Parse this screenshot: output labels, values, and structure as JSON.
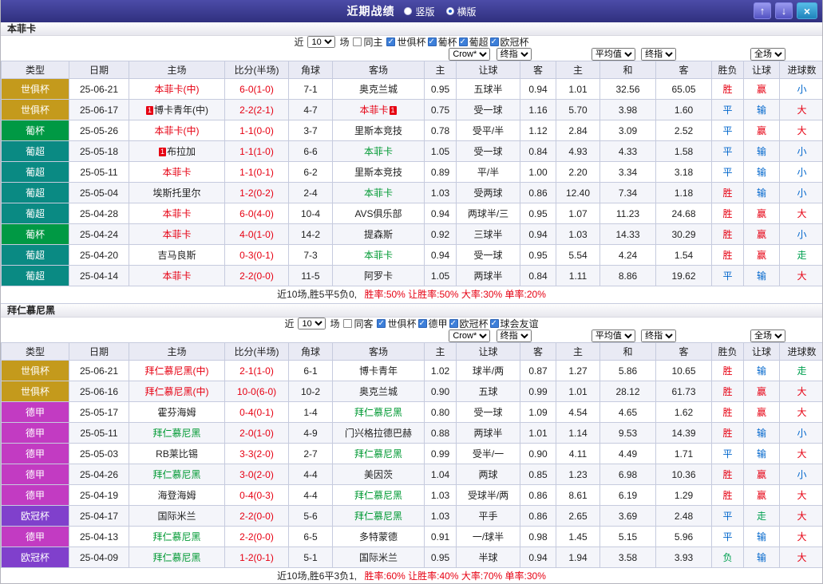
{
  "top_bar": {
    "title": "近期战绩",
    "view_options": [
      {
        "label": "竖版",
        "selected": false
      },
      {
        "label": "横版",
        "selected": true
      }
    ],
    "up_button": "↑",
    "down_button": "↓",
    "close_button": "×"
  },
  "filter_labels": {
    "prefix": "近",
    "suffix": "场"
  },
  "selects": {
    "bookmaker": "Crow*",
    "final1": "终指",
    "average": "平均值",
    "final2": "终指",
    "fulltime": "全场"
  },
  "table_columns": {
    "type": "类型",
    "date": "日期",
    "home": "主场",
    "score": "比分(半场)",
    "corner": "角球",
    "away": "客场",
    "ah_home": "主",
    "ah_line": "让球",
    "ah_away": "客",
    "eu_home": "主",
    "eu_draw": "和",
    "eu_away": "客",
    "res_wdl": "胜负",
    "res_ah": "让球",
    "res_ou": "进球数"
  },
  "colors": {
    "type_badges": {
      "世俱杯": "#c49a1c",
      "葡杯": "#009944",
      "葡超": "#0a8a83",
      "德甲": "#c23bc2",
      "欧冠杯": "#8040cc"
    },
    "results": {
      "胜": "#e60012",
      "平": "#0066cc",
      "负": "#00a050",
      "赢": "#e60012",
      "输": "#0066cc",
      "走": "#00a050",
      "大": "#e60012",
      "小": "#0066cc"
    },
    "team_red": "#e60012",
    "team_green": "#009933",
    "team_black": "#222222"
  },
  "sections": [
    {
      "team": "本菲卡",
      "filter": {
        "count": "10",
        "venue": {
          "label": "同主",
          "checked": false
        },
        "leagues": [
          {
            "label": "世俱杯",
            "checked": true
          },
          {
            "label": "葡杯",
            "checked": true
          },
          {
            "label": "葡超",
            "checked": true
          },
          {
            "label": "欧冠杯",
            "checked": true
          }
        ]
      },
      "rows": [
        {
          "type": "世俱杯",
          "date": "25-06-21",
          "home": "本菲卡(中)",
          "home_color": "red",
          "score": "6-0(1-0)",
          "corner": "7-1",
          "away": "奥克兰城",
          "away_color": "black",
          "ah": [
            "0.95",
            "五球半",
            "0.94"
          ],
          "eu": [
            "1.01",
            "32.56",
            "65.05"
          ],
          "res": [
            "胜",
            "赢",
            "小"
          ]
        },
        {
          "type": "世俱杯",
          "date": "25-06-17",
          "home": "博卡青年(中)",
          "home_color": "black",
          "home_card": "1",
          "home_card_pos": "before",
          "score": "2-2(2-1)",
          "corner": "4-7",
          "away": "本菲卡",
          "away_color": "red",
          "away_card": "1",
          "away_card_pos": "after",
          "ah": [
            "0.75",
            "受一球",
            "1.16"
          ],
          "eu": [
            "5.70",
            "3.98",
            "1.60"
          ],
          "res": [
            "平",
            "输",
            "大"
          ]
        },
        {
          "type": "葡杯",
          "date": "25-05-26",
          "home": "本菲卡(中)",
          "home_color": "red",
          "score": "1-1(0-0)",
          "corner": "3-7",
          "away": "里斯本竞技",
          "away_color": "black",
          "ah": [
            "0.78",
            "受平/半",
            "1.12"
          ],
          "eu": [
            "2.84",
            "3.09",
            "2.52"
          ],
          "res": [
            "平",
            "赢",
            "大"
          ]
        },
        {
          "type": "葡超",
          "date": "25-05-18",
          "home": "布拉加",
          "home_color": "black",
          "home_card": "1",
          "home_card_pos": "before",
          "score": "1-1(1-0)",
          "corner": "6-6",
          "away": "本菲卡",
          "away_color": "green",
          "ah": [
            "1.05",
            "受一球",
            "0.84"
          ],
          "eu": [
            "4.93",
            "4.33",
            "1.58"
          ],
          "res": [
            "平",
            "输",
            "小"
          ]
        },
        {
          "type": "葡超",
          "date": "25-05-11",
          "home": "本菲卡",
          "home_color": "red",
          "score": "1-1(0-1)",
          "corner": "6-2",
          "away": "里斯本竞技",
          "away_color": "black",
          "ah": [
            "0.89",
            "平/半",
            "1.00"
          ],
          "eu": [
            "2.20",
            "3.34",
            "3.18"
          ],
          "res": [
            "平",
            "输",
            "小"
          ]
        },
        {
          "type": "葡超",
          "date": "25-05-04",
          "home": "埃斯托里尔",
          "home_color": "black",
          "score": "1-2(0-2)",
          "corner": "2-4",
          "away": "本菲卡",
          "away_color": "green",
          "ah": [
            "1.03",
            "受两球",
            "0.86"
          ],
          "eu": [
            "12.40",
            "7.34",
            "1.18"
          ],
          "res": [
            "胜",
            "输",
            "小"
          ]
        },
        {
          "type": "葡超",
          "date": "25-04-28",
          "home": "本菲卡",
          "home_color": "red",
          "score": "6-0(4-0)",
          "corner": "10-4",
          "away": "AVS俱乐部",
          "away_color": "black",
          "ah": [
            "0.94",
            "两球半/三",
            "0.95"
          ],
          "eu": [
            "1.07",
            "11.23",
            "24.68"
          ],
          "res": [
            "胜",
            "赢",
            "大"
          ]
        },
        {
          "type": "葡杯",
          "date": "25-04-24",
          "home": "本菲卡",
          "home_color": "red",
          "score": "4-0(1-0)",
          "corner": "14-2",
          "away": "提森斯",
          "away_color": "black",
          "ah": [
            "0.92",
            "三球半",
            "0.94"
          ],
          "eu": [
            "1.03",
            "14.33",
            "30.29"
          ],
          "res": [
            "胜",
            "赢",
            "小"
          ]
        },
        {
          "type": "葡超",
          "date": "25-04-20",
          "home": "吉马良斯",
          "home_color": "black",
          "score": "0-3(0-1)",
          "corner": "7-3",
          "away": "本菲卡",
          "away_color": "green",
          "ah": [
            "0.94",
            "受一球",
            "0.95"
          ],
          "eu": [
            "5.54",
            "4.24",
            "1.54"
          ],
          "res": [
            "胜",
            "赢",
            "走"
          ]
        },
        {
          "type": "葡超",
          "date": "25-04-14",
          "home": "本菲卡",
          "home_color": "red",
          "score": "2-2(0-0)",
          "corner": "11-5",
          "away": "阿罗卡",
          "away_color": "black",
          "ah": [
            "1.05",
            "两球半",
            "0.84"
          ],
          "eu": [
            "1.11",
            "8.86",
            "19.62"
          ],
          "res": [
            "平",
            "输",
            "大"
          ]
        }
      ],
      "summary": {
        "intro": "近10场,胜5平5负0,",
        "stats": "胜率:50% 让胜率:50% 大率:30% 单率:20%"
      }
    },
    {
      "team": "拜仁慕尼黑",
      "filter": {
        "count": "10",
        "venue": {
          "label": "同客",
          "checked": false
        },
        "leagues": [
          {
            "label": "世俱杯",
            "checked": true
          },
          {
            "label": "德甲",
            "checked": true
          },
          {
            "label": "欧冠杯",
            "checked": true
          },
          {
            "label": "球会友谊",
            "checked": true
          }
        ]
      },
      "rows": [
        {
          "type": "世俱杯",
          "date": "25-06-21",
          "home": "拜仁慕尼黑(中)",
          "home_color": "red",
          "score": "2-1(1-0)",
          "corner": "6-1",
          "away": "博卡青年",
          "away_color": "black",
          "ah": [
            "1.02",
            "球半/两",
            "0.87"
          ],
          "eu": [
            "1.27",
            "5.86",
            "10.65"
          ],
          "res": [
            "胜",
            "输",
            "走"
          ]
        },
        {
          "type": "世俱杯",
          "date": "25-06-16",
          "home": "拜仁慕尼黑(中)",
          "home_color": "red",
          "score": "10-0(6-0)",
          "corner": "10-2",
          "away": "奥克兰城",
          "away_color": "black",
          "ah": [
            "0.90",
            "五球",
            "0.99"
          ],
          "eu": [
            "1.01",
            "28.12",
            "61.73"
          ],
          "res": [
            "胜",
            "赢",
            "大"
          ]
        },
        {
          "type": "德甲",
          "date": "25-05-17",
          "home": "霍芬海姆",
          "home_color": "black",
          "score": "0-4(0-1)",
          "corner": "1-4",
          "away": "拜仁慕尼黑",
          "away_color": "green",
          "ah": [
            "0.80",
            "受一球",
            "1.09"
          ],
          "eu": [
            "4.54",
            "4.65",
            "1.62"
          ],
          "res": [
            "胜",
            "赢",
            "大"
          ]
        },
        {
          "type": "德甲",
          "date": "25-05-11",
          "home": "拜仁慕尼黑",
          "home_color": "green",
          "score": "2-0(1-0)",
          "corner": "4-9",
          "away": "门兴格拉德巴赫",
          "away_color": "black",
          "ah": [
            "0.88",
            "两球半",
            "1.01"
          ],
          "eu": [
            "1.14",
            "9.53",
            "14.39"
          ],
          "res": [
            "胜",
            "输",
            "小"
          ]
        },
        {
          "type": "德甲",
          "date": "25-05-03",
          "home": "RB莱比锡",
          "home_color": "black",
          "score": "3-3(2-0)",
          "corner": "2-7",
          "away": "拜仁慕尼黑",
          "away_color": "green",
          "ah": [
            "0.99",
            "受半/一",
            "0.90"
          ],
          "eu": [
            "4.11",
            "4.49",
            "1.71"
          ],
          "res": [
            "平",
            "输",
            "大"
          ]
        },
        {
          "type": "德甲",
          "date": "25-04-26",
          "home": "拜仁慕尼黑",
          "home_color": "green",
          "score": "3-0(2-0)",
          "corner": "4-4",
          "away": "美因茨",
          "away_color": "black",
          "ah": [
            "1.04",
            "两球",
            "0.85"
          ],
          "eu": [
            "1.23",
            "6.98",
            "10.36"
          ],
          "res": [
            "胜",
            "赢",
            "小"
          ]
        },
        {
          "type": "德甲",
          "date": "25-04-19",
          "home": "海登海姆",
          "home_color": "black",
          "score": "0-4(0-3)",
          "corner": "4-4",
          "away": "拜仁慕尼黑",
          "away_color": "green",
          "ah": [
            "1.03",
            "受球半/两",
            "0.86"
          ],
          "eu": [
            "8.61",
            "6.19",
            "1.29"
          ],
          "res": [
            "胜",
            "赢",
            "大"
          ]
        },
        {
          "type": "欧冠杯",
          "date": "25-04-17",
          "home": "国际米兰",
          "home_color": "black",
          "score": "2-2(0-0)",
          "corner": "5-6",
          "away": "拜仁慕尼黑",
          "away_color": "green",
          "ah": [
            "1.03",
            "平手",
            "0.86"
          ],
          "eu": [
            "2.65",
            "3.69",
            "2.48"
          ],
          "res": [
            "平",
            "走",
            "大"
          ]
        },
        {
          "type": "德甲",
          "date": "25-04-13",
          "home": "拜仁慕尼黑",
          "home_color": "green",
          "score": "2-2(0-0)",
          "corner": "6-5",
          "away": "多特蒙德",
          "away_color": "black",
          "ah": [
            "0.91",
            "一/球半",
            "0.98"
          ],
          "eu": [
            "1.45",
            "5.15",
            "5.96"
          ],
          "res": [
            "平",
            "输",
            "大"
          ]
        },
        {
          "type": "欧冠杯",
          "date": "25-04-09",
          "home": "拜仁慕尼黑",
          "home_color": "green",
          "score": "1-2(0-1)",
          "corner": "5-1",
          "away": "国际米兰",
          "away_color": "black",
          "ah": [
            "0.95",
            "半球",
            "0.94"
          ],
          "eu": [
            "1.94",
            "3.58",
            "3.93"
          ],
          "res": [
            "负",
            "输",
            "大"
          ]
        }
      ],
      "summary": {
        "intro": "近10场,胜6平3负1,",
        "stats": "胜率:60% 让胜率:40% 大率:70% 单率:30%"
      }
    }
  ]
}
